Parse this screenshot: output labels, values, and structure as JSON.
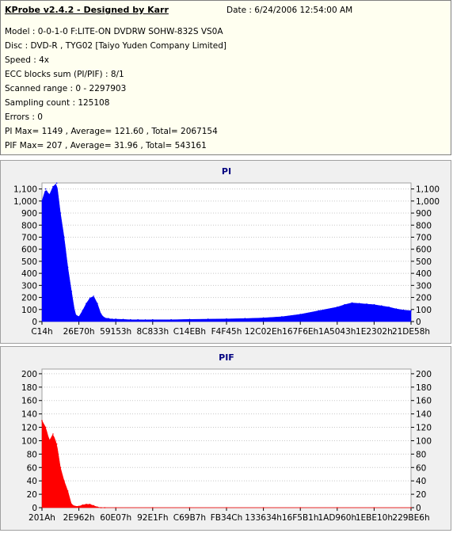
{
  "header": {
    "title": "KProbe v2.4.2 - Designed by Karr",
    "date": "Date : 6/24/2006 12:54:00 AM"
  },
  "info_lines": [
    "Model : 0-0-1-0 F:LITE-ON DVDRW SOHW-832S  VS0A",
    "Disc : DVD-R , TYG02 [Taiyo Yuden Company Limited]",
    "Speed : 4x",
    "ECC blocks sum (PI/PIF) : 8/1",
    "Scanned range : 0 - 2297903",
    "Sampling count : 125108",
    "Errors : 0",
    "PI Max= 1149 , Average= 121.60 , Total= 2067154",
    "PIF Max= 207 , Average= 31.96 , Total= 543161"
  ],
  "colors": {
    "pi": "#0000ff",
    "pif": "#ff0000",
    "title": "#000080",
    "info_bg": "#fffff0",
    "panel_bg": "#f0f0f0"
  },
  "chart_data": [
    {
      "type": "area",
      "title": "PI",
      "ylim": [
        0,
        1150
      ],
      "yticks": [
        0,
        100,
        200,
        300,
        400,
        500,
        600,
        700,
        800,
        900,
        1000,
        1100
      ],
      "ytick_labels": [
        "0",
        "100",
        "200",
        "300",
        "400",
        "500",
        "600",
        "700",
        "800",
        "900",
        "1,000",
        "1,100"
      ],
      "xtick_labels": [
        "C14h",
        "26E70h",
        "59153h",
        "8C833h",
        "C14EBh",
        "F4F45h",
        "12C02Eh",
        "167F6Eh",
        "1A5043h",
        "1E2302h",
        "21DE58h"
      ],
      "x": [
        0,
        0.01,
        0.02,
        0.03,
        0.04,
        0.05,
        0.06,
        0.07,
        0.08,
        0.09,
        0.1,
        0.11,
        0.12,
        0.13,
        0.14,
        0.15,
        0.16,
        0.17,
        0.18,
        0.19,
        0.2,
        0.22,
        0.24,
        0.26,
        0.28,
        0.3,
        0.35,
        0.4,
        0.45,
        0.5,
        0.55,
        0.6,
        0.65,
        0.7,
        0.75,
        0.8,
        0.82,
        0.84,
        0.86,
        0.88,
        0.9,
        0.92,
        0.94,
        0.96,
        0.98,
        1.0
      ],
      "values": [
        1000,
        1100,
        1050,
        1120,
        1149,
        900,
        700,
        450,
        250,
        60,
        40,
        90,
        150,
        195,
        210,
        150,
        60,
        30,
        25,
        20,
        20,
        18,
        15,
        15,
        14,
        15,
        15,
        18,
        20,
        22,
        25,
        30,
        40,
        60,
        90,
        120,
        140,
        155,
        150,
        145,
        140,
        130,
        120,
        105,
        95,
        90
      ],
      "grid": true,
      "grid_style": "dashed"
    },
    {
      "type": "area",
      "title": "PIF",
      "ylim": [
        0,
        207
      ],
      "yticks": [
        0,
        20,
        40,
        60,
        80,
        100,
        120,
        140,
        160,
        180,
        200
      ],
      "ytick_labels": [
        "0",
        "20",
        "40",
        "60",
        "80",
        "100",
        "120",
        "140",
        "160",
        "180",
        "200"
      ],
      "xtick_labels": [
        "201Ah",
        "2E962h",
        "60E07h",
        "92E1Fh",
        "C69B7h",
        "FB34Ch",
        "133634h",
        "16F5B1h",
        "1AD960h",
        "1EBE10h",
        "229BE6h"
      ],
      "x": [
        0,
        0.01,
        0.02,
        0.03,
        0.04,
        0.05,
        0.06,
        0.07,
        0.08,
        0.09,
        0.1,
        0.11,
        0.12,
        0.13,
        0.14,
        0.15,
        0.16,
        0.17,
        0.2,
        0.3,
        0.4,
        0.5,
        0.6,
        0.7,
        0.8,
        0.9,
        1.0
      ],
      "values": [
        130,
        120,
        100,
        110,
        95,
        60,
        40,
        25,
        5,
        2,
        2,
        4,
        5,
        5,
        3,
        1,
        0,
        0,
        0,
        0,
        0,
        0,
        0,
        0,
        0,
        0,
        0
      ],
      "grid": true,
      "grid_style": "dashed"
    }
  ]
}
